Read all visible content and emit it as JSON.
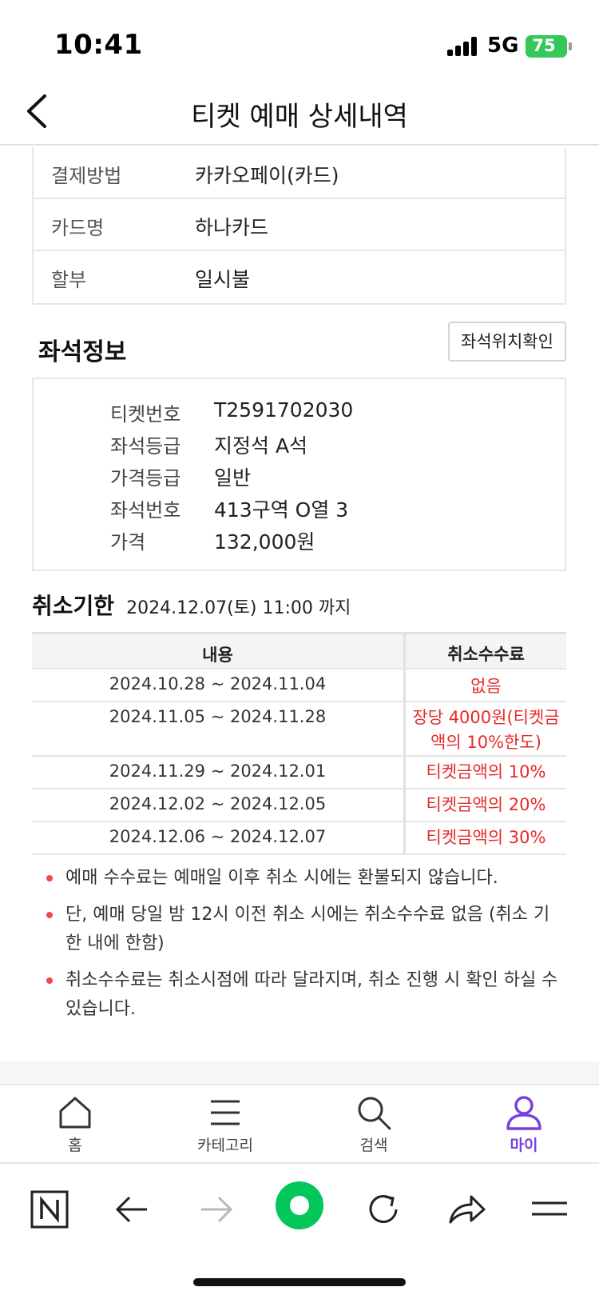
{
  "status_bar": {
    "time": "10:41",
    "network": "5G",
    "battery": "75"
  },
  "header": {
    "title": "티켓 예매 상세내역"
  },
  "payment": [
    {
      "label": "결제방법",
      "value": "카카오페이(카드)"
    },
    {
      "label": "카드명",
      "value": "하나카드"
    },
    {
      "label": "할부",
      "value": "일시불"
    }
  ],
  "seat_info": {
    "title": "좌석정보",
    "location_button": "좌석위치확인",
    "rows": [
      {
        "label": "티켓번호",
        "value": "T2591702030"
      },
      {
        "label": "좌석등급",
        "value": "지정석 A석"
      },
      {
        "label": "가격등급",
        "value": "일반"
      },
      {
        "label": "좌석번호",
        "value": "413구역 O열 3"
      },
      {
        "label": "가격",
        "value": "132,000원"
      }
    ]
  },
  "cancel": {
    "title": "취소기한",
    "deadline": "2024.12.07(토) 11:00 까지",
    "table_headers": {
      "period": "내용",
      "fee": "취소수수료"
    },
    "rows": [
      {
        "period": "2024.10.28 ~ 2024.11.04",
        "fee": "없음"
      },
      {
        "period": "2024.11.05 ~ 2024.11.28",
        "fee": "장당 4000원(티켓금액의 10%한도)"
      },
      {
        "period": "2024.11.29 ~ 2024.12.01",
        "fee": "티켓금액의 10%"
      },
      {
        "period": "2024.12.02 ~ 2024.12.05",
        "fee": "티켓금액의 20%"
      },
      {
        "period": "2024.12.06 ~ 2024.12.07",
        "fee": "티켓금액의 30%"
      }
    ],
    "notes": [
      "예매 수수료는 예매일 이후 취소 시에는 환불되지 않습니다.",
      "단, 예매 당일 밤 12시 이전 취소 시에는 취소수수료 없음 (취소 기한 내에 한함)",
      "취소수수료는 취소시점에 따라 달라지며, 취소 진행 시 확인 하실 수 있습니다."
    ]
  },
  "tab_bar": {
    "home": "홈",
    "category": "카테고리",
    "search": "검색",
    "my": "마이",
    "active": "my"
  },
  "colors": {
    "accent": "#7b3fe0",
    "fee_red": "#e62a2a",
    "battery_green": "#34c759",
    "naver_green": "#03c75a"
  }
}
